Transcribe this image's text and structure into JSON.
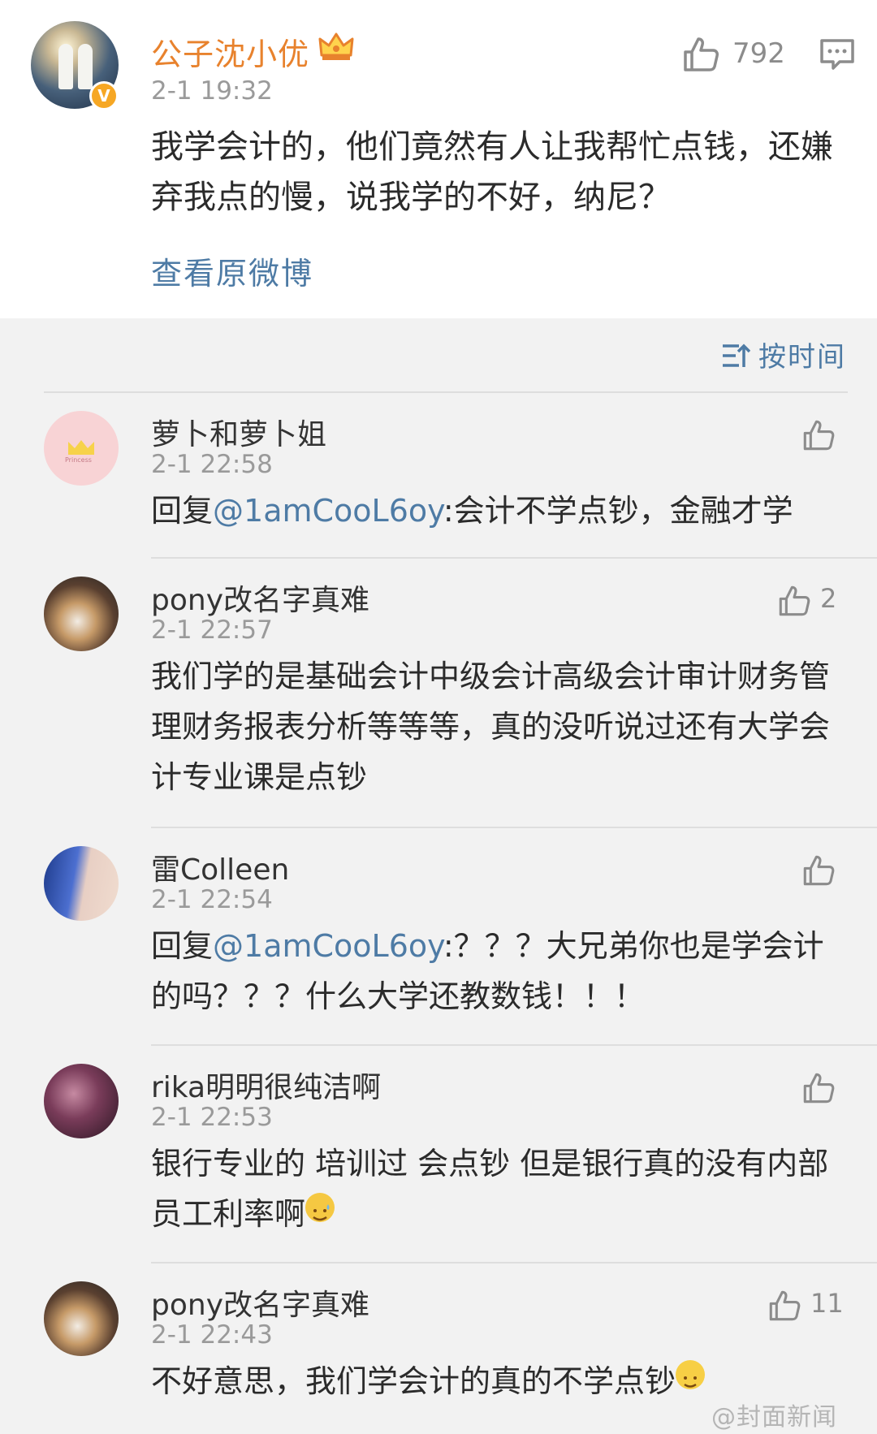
{
  "post": {
    "author": "公子沈小优",
    "time": "2-1 19:32",
    "likes": "792",
    "text": "我学会计的，他们竟然有人让我帮忙点钱，还嫌弃我点的慢，说我学的不好，纳尼？",
    "view_original": "查看原微博",
    "icons": {
      "verified": "verified-v-icon",
      "vip": "crown-icon",
      "like": "thumbs-up-icon",
      "comment": "comment-bubble-icon"
    },
    "verified_mark": "V"
  },
  "sort": {
    "label": "按时间",
    "icon": "sort-icon"
  },
  "comments": [
    {
      "name": "萝卜和萝卜姐",
      "time": "2-1 22:58",
      "reply_prefix": "回复",
      "mention": "@1amCooL6oy",
      "text": ":会计不学点钞，金融才学",
      "likes": "",
      "avatar_text": "Princess"
    },
    {
      "name": "pony改名字真难",
      "time": "2-1 22:57",
      "text": "我们学的是基础会计中级会计高级会计审计财务管理财务报表分析等等等，真的没听说过还有大学会计专业课是点钞",
      "likes": "2"
    },
    {
      "name": "雷Colleen",
      "time": "2-1 22:54",
      "reply_prefix": "回复",
      "mention": "@1amCooL6oy",
      "text": ":？？？大兄弟你也是学会计的吗？？？什么大学还教数钱！！！",
      "likes": ""
    },
    {
      "name": "rika明明很纯洁啊",
      "time": "2-1 22:53",
      "text": "银行专业的 培训过 会点钞 但是银行真的没有内部员工利率啊",
      "likes": "",
      "emoji": "sweat-smile-emoji"
    },
    {
      "name": "pony改名字真难",
      "time": "2-1 22:43",
      "text": "不好意思，我们学会计的真的不学点钞",
      "likes": "11",
      "emoji": "smile-emoji"
    }
  ],
  "watermark": "@封面新闻",
  "colors": {
    "author": "#e8822d",
    "link": "#4e7ba5",
    "muted": "#9a9a9a",
    "text": "#2b2b2b",
    "background": "#f2f2f2"
  }
}
